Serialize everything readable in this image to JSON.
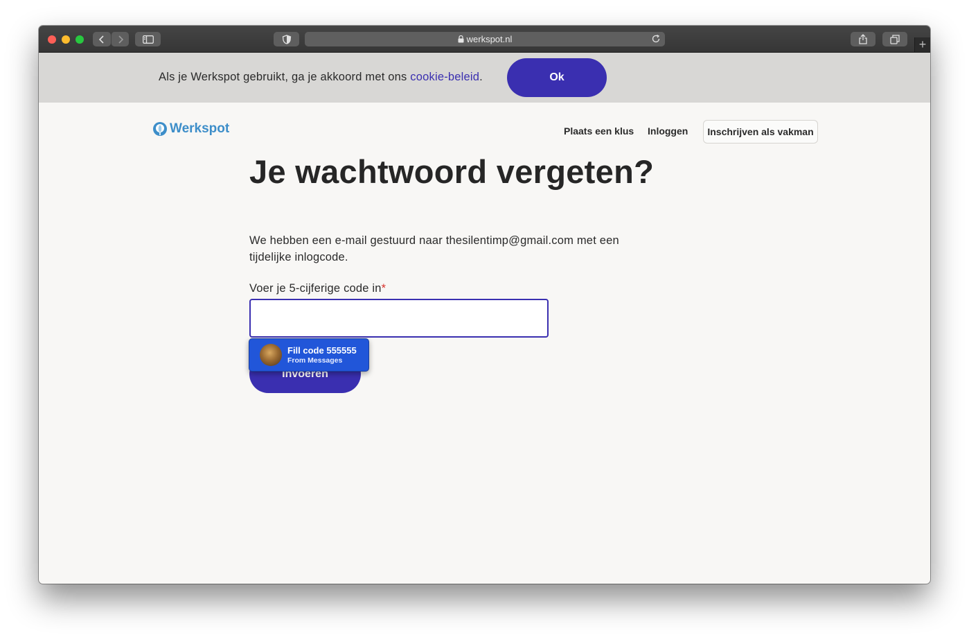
{
  "browser": {
    "url": "werkspot.nl"
  },
  "cookie_banner": {
    "text": "Als je Werkspot gebruikt, ga je akkoord met ons ",
    "link": "cookie-beleid",
    "suffix": ".",
    "ok_label": "Ok"
  },
  "header": {
    "logo_text": "Werkspot",
    "nav": {
      "place_job": "Plaats een klus",
      "login": "Inloggen",
      "signup": "Inschrijven als vakman"
    }
  },
  "main": {
    "title": "Je wachtwoord vergeten?",
    "description": "We hebben een e-mail gestuurd naar thesilentimp@gmail.com met een tijdelijke inlogcode.",
    "code_label": "Voer je 5-cijferige code in",
    "required_marker": "*",
    "code_value": "",
    "submit_label": "Invoeren"
  },
  "autofill": {
    "title": "Fill code 555555",
    "subtitle": "From Messages"
  },
  "colors": {
    "brand_primary": "#3a2fb0",
    "logo_blue": "#3d8ec9",
    "autofill_blue": "#2156d9"
  }
}
